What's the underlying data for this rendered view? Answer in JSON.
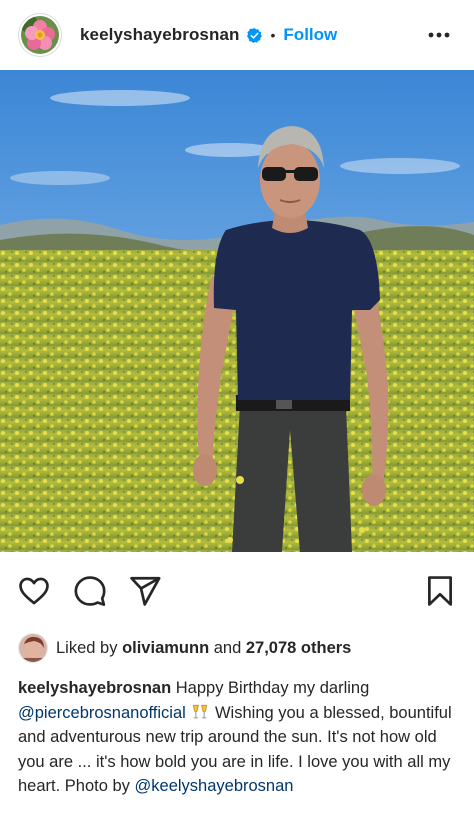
{
  "header": {
    "avatar_icon": "flower-avatar-icon",
    "username": "keelyshayebrosnan",
    "verified_icon": "verified-badge-icon",
    "separator": "•",
    "follow_label": "Follow",
    "more_icon": "more-options-icon"
  },
  "post": {
    "image_subject": "man-in-flower-field-photo"
  },
  "actions": {
    "like_icon": "heart-icon",
    "comment_icon": "comment-icon",
    "share_icon": "share-icon",
    "save_icon": "bookmark-icon"
  },
  "likes": {
    "prefix": "Liked by",
    "user": "oliviamunn",
    "middle": "and",
    "count": "27,078 others"
  },
  "caption": {
    "username": "keelyshayebrosnan",
    "text_1": "Happy Birthday my darling",
    "mention_1": "@piercebrosnanofficial",
    "emoji": "champagne-toast-emoji",
    "text_2": "Wishing you a blessed, bountiful and adventurous new trip around the sun. It's not how old you are ... it's how bold you are in life. I love you with all my heart. Photo by",
    "mention_2": "@keelyshayebrosnan"
  },
  "colors": {
    "link_blue": "#0095f6",
    "mention_blue": "#00376b",
    "text": "#262626"
  }
}
